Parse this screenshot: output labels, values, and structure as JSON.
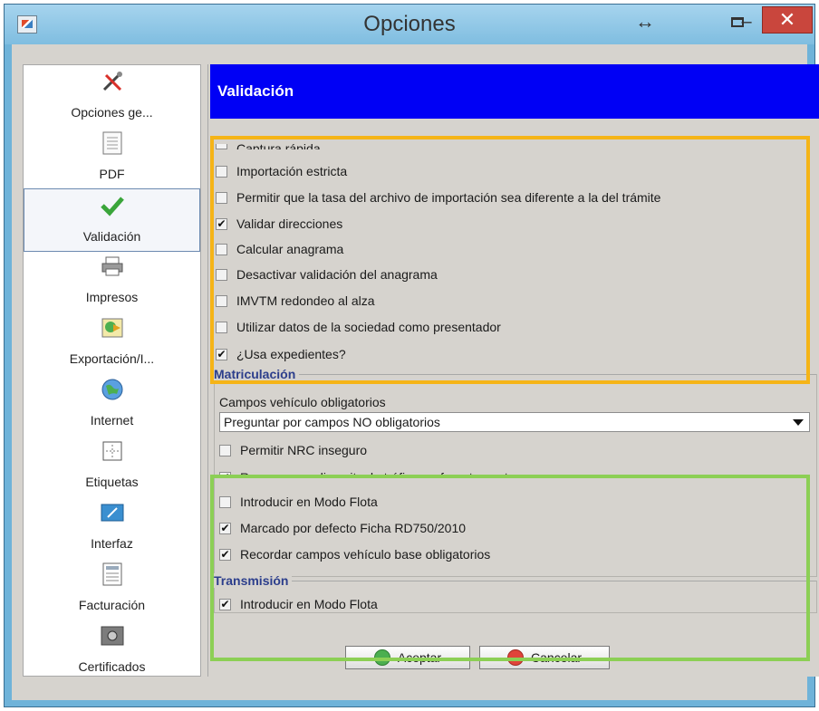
{
  "window": {
    "title": "Opciones",
    "move_glyph": "↔",
    "minimize_glyph": "–",
    "close_glyph": "✕"
  },
  "sidebar": {
    "items": [
      {
        "label": "Opciones ge...",
        "icon": "tools-icon"
      },
      {
        "label": "PDF",
        "icon": "document-icon"
      },
      {
        "label": "Validación",
        "icon": "checkmark-icon",
        "selected": true
      },
      {
        "label": "Impresos",
        "icon": "printer-icon"
      },
      {
        "label": "Exportación/I...",
        "icon": "export-icon"
      },
      {
        "label": "Internet",
        "icon": "globe-icon"
      },
      {
        "label": "Etiquetas",
        "icon": "label-icon"
      },
      {
        "label": "Interfaz",
        "icon": "interface-icon"
      },
      {
        "label": "Facturación",
        "icon": "invoice-icon"
      },
      {
        "label": "Certificados",
        "icon": "certificate-icon"
      }
    ]
  },
  "panel": {
    "header": "Validación",
    "partial_top_option": "Captura rápida",
    "validation_options": [
      {
        "label": "Importación estricta",
        "checked": false
      },
      {
        "label": "Permitir que la tasa del archivo de importación sea diferente a la del trámite",
        "checked": false
      },
      {
        "label": "Validar direcciones",
        "checked": true
      },
      {
        "label": "Calcular anagrama",
        "checked": false
      },
      {
        "label": "Desactivar validación del anagrama",
        "checked": false
      },
      {
        "label": "IMVTM redondeo al alza",
        "checked": false
      },
      {
        "label": "Utilizar datos de la sociedad como presentador",
        "checked": false
      },
      {
        "label": "¿Usa expedientes?",
        "checked": true
      }
    ],
    "matriculacion": {
      "title": "Matriculación",
      "fields_label": "Campos vehículo obligatorios",
      "dropdown_value": "Preguntar por campos NO obligatorios",
      "options": [
        {
          "label": "Permitir NRC inseguro",
          "checked": false
        },
        {
          "label": "Recuperar codigos itv de tráfico preferentemente",
          "checked": true
        },
        {
          "label": "Introducir en Modo Flota",
          "checked": false
        },
        {
          "label": "Marcado por defecto Ficha RD750/2010",
          "checked": true
        },
        {
          "label": "Recordar campos vehículo base obligatorios",
          "checked": true
        }
      ]
    },
    "transmision": {
      "title": "Transmisión",
      "options": [
        {
          "label": "Introducir en Modo Flota",
          "checked": true
        }
      ]
    },
    "buttons": {
      "accept": "Aceptar",
      "cancel": "Cancelar"
    }
  },
  "colors": {
    "header_blue": "#0000f5",
    "highlight_orange": "#f5b417",
    "highlight_green": "#8ccf55",
    "close_red": "#c9463d",
    "titlebar": "#8cc6e7"
  }
}
